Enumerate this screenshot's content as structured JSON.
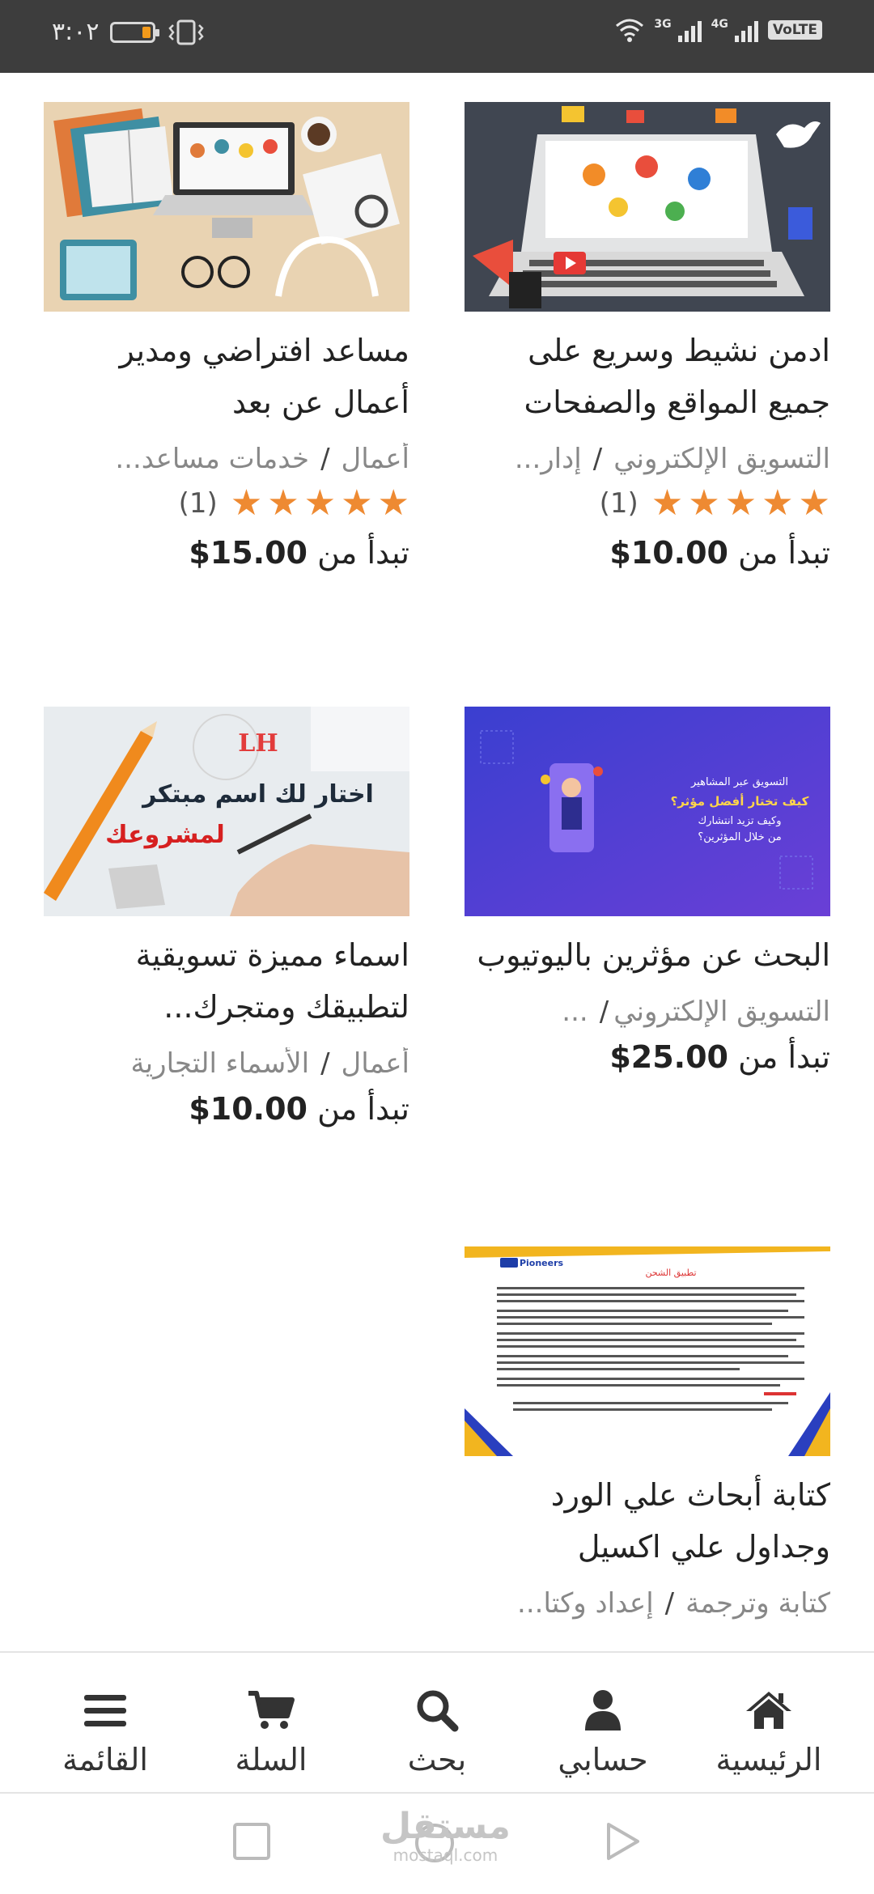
{
  "status_bar": {
    "time": "٣:٠٢",
    "network_3g": "3G",
    "network_4g": "4G",
    "volte": "VoLTE",
    "battery_level_percent": 25
  },
  "products": [
    {
      "title": "ادمن نشيط وسريع على جميع المواقع والصفحات",
      "category": "التسويق الإلكتروني",
      "subcategory": "إدار...",
      "rating_count": "(1)",
      "price_prefix": "تبدأ من",
      "price": "$10.00",
      "image_icon": "social-media-laptop-image"
    },
    {
      "title": "مساعد افتراضي ومدير أعمال عن بعد",
      "category": "أعمال",
      "subcategory": "خدمات مساعد...",
      "rating_count": "(1)",
      "price_prefix": "تبدأ من",
      "price": "$15.00",
      "image_icon": "desk-workspace-image"
    },
    {
      "title": "البحث عن مؤثرين باليوتيوب",
      "category": "التسويق الإلكتروني",
      "subcategory": "...",
      "price_prefix": "تبدأ من",
      "price": "$25.00",
      "image_icon": "influencer-banner-image",
      "image_text": [
        "التسويق عبر المشاهير",
        "كيف تختار أفضل مؤثر؟",
        "وكيف تزيد انتشارك",
        "من خلال المؤثرين؟"
      ]
    },
    {
      "title": "اسماء مميزة تسويقية لتطبيقك ومتجرك...",
      "category": "أعمال",
      "subcategory": "الأسماء التجارية",
      "price_prefix": "تبدأ من",
      "price": "$10.00",
      "image_icon": "creative-name-image",
      "image_text": [
        "اختار لك اسم مبتكر",
        "لمشروعك",
        "LH"
      ]
    },
    {
      "title": "كتابة أبحاث علي الورد وجداول علي اكسيل",
      "category": "كتابة وترجمة",
      "subcategory": "إعداد وكتا...",
      "image_icon": "document-page-image",
      "image_text": [
        "Pioneers",
        "تطبيق الشحن"
      ]
    }
  ],
  "bottom_nav": [
    {
      "label": "الرئيسية",
      "icon": "home-icon"
    },
    {
      "label": "حسابي",
      "icon": "user-icon"
    },
    {
      "label": "بحث",
      "icon": "search-icon"
    },
    {
      "label": "السلة",
      "icon": "cart-icon"
    },
    {
      "label": "القائمة",
      "icon": "menu-icon"
    }
  ],
  "watermark": {
    "arabic": "مستقل",
    "latin": "mostaql.com"
  },
  "colors": {
    "star": "#ee8a32",
    "status_bar": "#3d3d3d",
    "battery": "#f29a1b"
  }
}
